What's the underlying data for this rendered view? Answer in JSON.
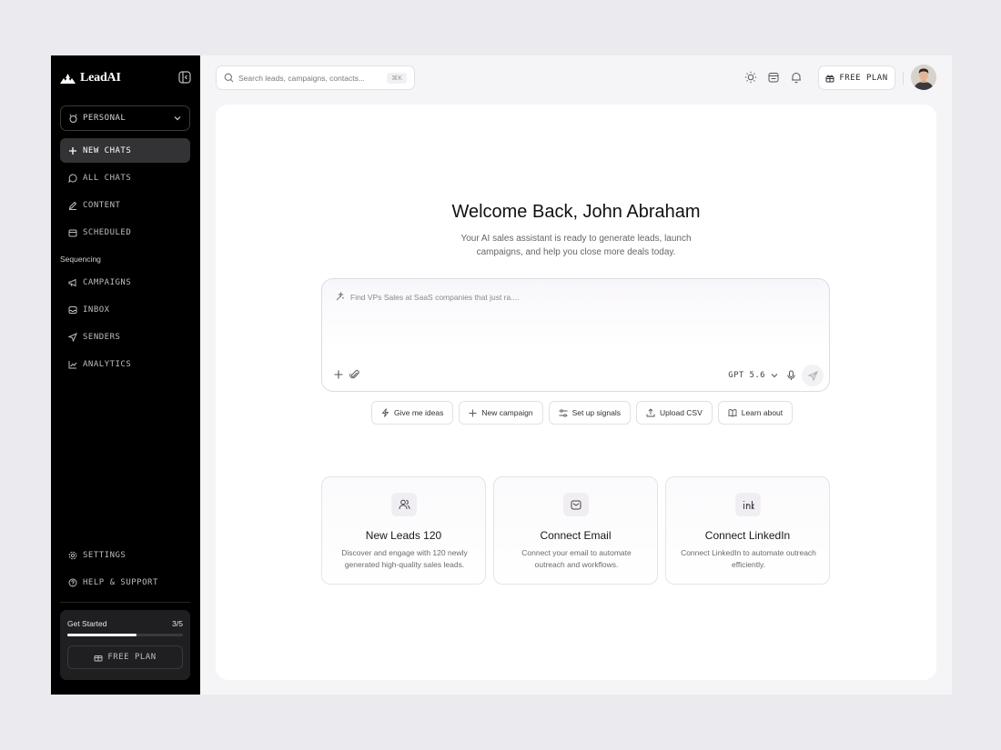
{
  "app": {
    "name": "LeadAI"
  },
  "workspace": {
    "label": "PERSONAL"
  },
  "nav": {
    "new_chats": "NEW CHATS",
    "all_chats": "ALL CHATS",
    "content": "CONTENT",
    "scheduled": "SCHEDULED",
    "section_sequencing": "Sequencing",
    "campaigns": "CAMPAIGNS",
    "inbox": "INBOX",
    "senders": "SENDERS",
    "analytics": "ANALYTICS",
    "settings": "SETTINGS",
    "help": "HELP & SUPPORT"
  },
  "get_started": {
    "label": "Get Started",
    "count": "3/5",
    "progress": 0.6,
    "button": "FREE PLAN"
  },
  "search": {
    "placeholder": "Search leads, campaigns, contacts...",
    "shortcut": "⌘K"
  },
  "header": {
    "plan_button": "FREE PLAN"
  },
  "welcome": {
    "title": "Welcome Back, John Abraham",
    "subtitle": "Your AI sales assistant is ready to generate leads, launch campaigns, and help you close more deals today."
  },
  "composer": {
    "placeholder": "Find VPs Sales at SaaS companies that just ra....",
    "model": "GPT 5.6"
  },
  "chips": [
    "Give me ideas",
    "New campaign",
    "Set up signals",
    "Upload CSV",
    "Learn about"
  ],
  "cards": [
    {
      "title": "New Leads 120",
      "desc": "Discover and engage with 120 newly generated high-quality sales leads.",
      "icon": "users-icon"
    },
    {
      "title": "Connect Email",
      "desc": "Connect your email to automate outreach and workflows.",
      "icon": "mail-icon"
    },
    {
      "title": "Connect LinkedIn",
      "desc": "Connect LinkedIn to automate outreach efficiently.",
      "icon": "linkedin-icon"
    }
  ]
}
